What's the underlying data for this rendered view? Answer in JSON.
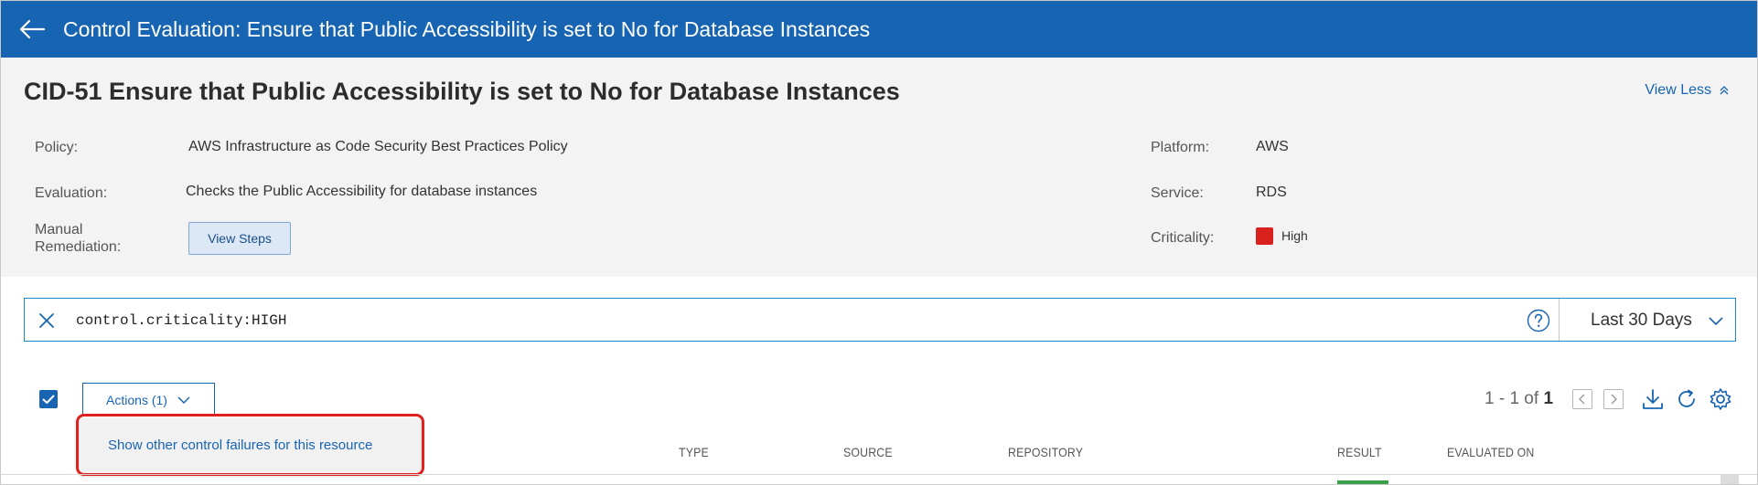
{
  "header": {
    "title": "Control Evaluation: Ensure that Public Accessibility is set to No for Database Instances"
  },
  "details": {
    "control_title": "CID-51 Ensure that Public Accessibility is set to No for Database Instances",
    "view_less_label": "View Less",
    "policy_label": "Policy:",
    "policy_value": "AWS Infrastructure as Code Security Best Practices Policy",
    "evaluation_label": "Evaluation:",
    "evaluation_value": "Checks the Public Accessibility for database instances",
    "manual_remediation_label": "Manual Remediation:",
    "view_steps_label": "View Steps",
    "platform_label": "Platform:",
    "platform_value": "AWS",
    "service_label": "Service:",
    "service_value": "RDS",
    "criticality_label": "Criticality:",
    "criticality_value": "High",
    "criticality_color": "#d8201c"
  },
  "search": {
    "query": "control.criticality:HIGH",
    "date_range": "Last 30 Days"
  },
  "toolbar": {
    "actions_label": "Actions (1)",
    "menu_items": [
      "Show other control failures for this resource"
    ],
    "pager_range": "1 - 1 of",
    "pager_total": "1"
  },
  "table": {
    "columns": [
      "TYPE",
      "SOURCE",
      "REPOSITORY",
      "RESULT",
      "EVALUATED ON"
    ]
  },
  "colors": {
    "brand": "#1764b3",
    "highlight": "#e0201c",
    "pass": "#3aa14a"
  }
}
